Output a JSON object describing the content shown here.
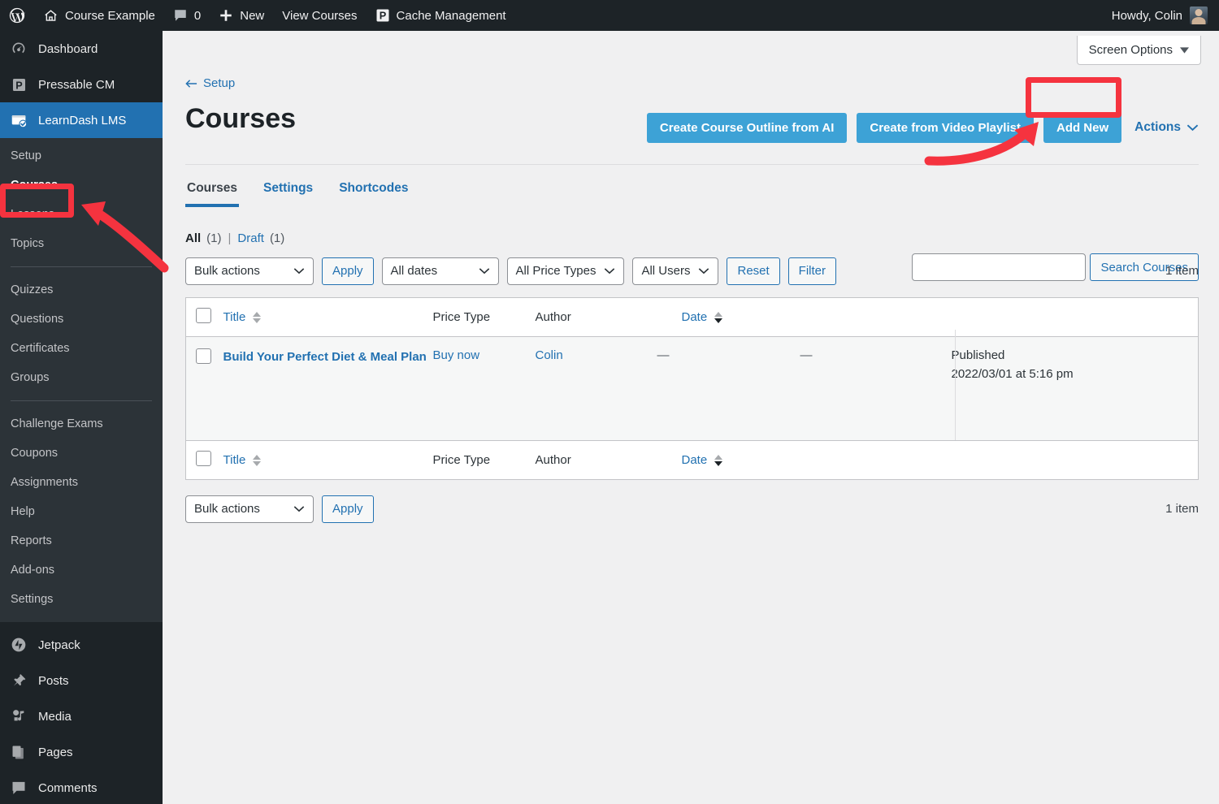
{
  "adminbar": {
    "logo_icon": "wordpress-icon",
    "site_icon": "home-icon",
    "site_name": "Course Example",
    "comments_icon": "comment-bubble-icon",
    "comments_count": "0",
    "new_icon": "plus-icon",
    "new_label": "New",
    "view_courses_label": "View Courses",
    "cache_icon": "pressable-p-icon",
    "cache_label": "Cache Management",
    "howdy": "Howdy, Colin",
    "avatar_icon": "user-avatar"
  },
  "sidebar": {
    "top_items": [
      {
        "label": "Dashboard",
        "icon": "dashboard-gauge-icon"
      },
      {
        "label": "Pressable CM",
        "icon": "pressable-p-icon"
      },
      {
        "label": "LearnDash LMS",
        "icon": "learndash-icon",
        "current": true
      }
    ],
    "submenu": [
      {
        "label": "Setup"
      },
      {
        "label": "Courses",
        "active": true
      },
      {
        "label": "Lessons"
      },
      {
        "label": "Topics"
      },
      {
        "separator": true
      },
      {
        "label": "Quizzes"
      },
      {
        "label": "Questions"
      },
      {
        "label": "Certificates"
      },
      {
        "label": "Groups"
      },
      {
        "separator": true
      },
      {
        "label": "Challenge Exams"
      },
      {
        "label": "Coupons"
      },
      {
        "label": "Assignments"
      },
      {
        "label": "Help"
      },
      {
        "label": "Reports"
      },
      {
        "label": "Add-ons"
      },
      {
        "label": "Settings"
      }
    ],
    "lower_items": [
      {
        "label": "Jetpack",
        "icon": "jetpack-icon"
      },
      {
        "label": "Posts",
        "icon": "pin-icon"
      },
      {
        "label": "Media",
        "icon": "media-icon"
      },
      {
        "label": "Pages",
        "icon": "pages-icon"
      },
      {
        "label": "Comments",
        "icon": "comment-bubble-icon"
      }
    ]
  },
  "screen_options": {
    "label": "Screen Options",
    "caret_icon": "caret-down-icon"
  },
  "header": {
    "back_icon": "arrow-left-icon",
    "back_label": "Setup",
    "page_title": "Courses",
    "buttons": [
      {
        "label": "Create Course Outline from AI",
        "name": "create-course-outline-from-ai-button"
      },
      {
        "label": "Create from Video Playlist",
        "name": "create-from-video-playlist-button"
      },
      {
        "label": "Add New",
        "name": "add-new-button"
      }
    ],
    "actions_label": "Actions",
    "actions_caret_icon": "chevron-down-icon"
  },
  "tabs": [
    {
      "label": "Courses",
      "active": true
    },
    {
      "label": "Settings",
      "active": false
    },
    {
      "label": "Shortcodes",
      "active": false
    }
  ],
  "views": {
    "all_label": "All",
    "all_count": "(1)",
    "separator": "|",
    "draft_label": "Draft",
    "draft_count": "(1)"
  },
  "search": {
    "value": "",
    "placeholder": "",
    "button_label": "Search Courses"
  },
  "tablenav_top": {
    "bulk_actions": "Bulk actions",
    "apply_label": "Apply",
    "all_dates": "All dates",
    "all_price_types": "All Price Types",
    "all_users": "All Users",
    "reset_label": "Reset",
    "filter_label": "Filter",
    "item_count": "1 item"
  },
  "tablenav_bottom": {
    "bulk_actions": "Bulk actions",
    "apply_label": "Apply",
    "item_count": "1 item"
  },
  "table": {
    "columns": [
      {
        "label": "Title",
        "sortable": true,
        "key": "title"
      },
      {
        "label": "Price Type",
        "sortable": false,
        "key": "price_type"
      },
      {
        "label": "Author",
        "sortable": false,
        "key": "author"
      },
      {
        "label": "",
        "sortable": false,
        "key": "col_blank_1"
      },
      {
        "label": "",
        "sortable": false,
        "key": "col_blank_2"
      },
      {
        "label": "Date",
        "sortable": true,
        "sorted": "desc",
        "key": "date"
      }
    ],
    "rows": [
      {
        "title": "Build Your Perfect Diet & Meal Plan",
        "price_type": "Buy now",
        "author": "Colin",
        "col_blank_1": "—",
        "col_blank_2": "—",
        "date_status": "Published",
        "date_value": "2022/03/01 at 5:16 pm"
      }
    ]
  },
  "annotations": {
    "highlight_color": "#f5333f",
    "box_courses_target": "Courses",
    "box_addnew_target": "Add New"
  },
  "colors": {
    "accent_blue": "#3da2d6",
    "link_blue": "#2271b1",
    "sidebar_dark": "#1d2327",
    "submenu_dark": "#2c3338",
    "annotation_red": "#f5333f"
  }
}
